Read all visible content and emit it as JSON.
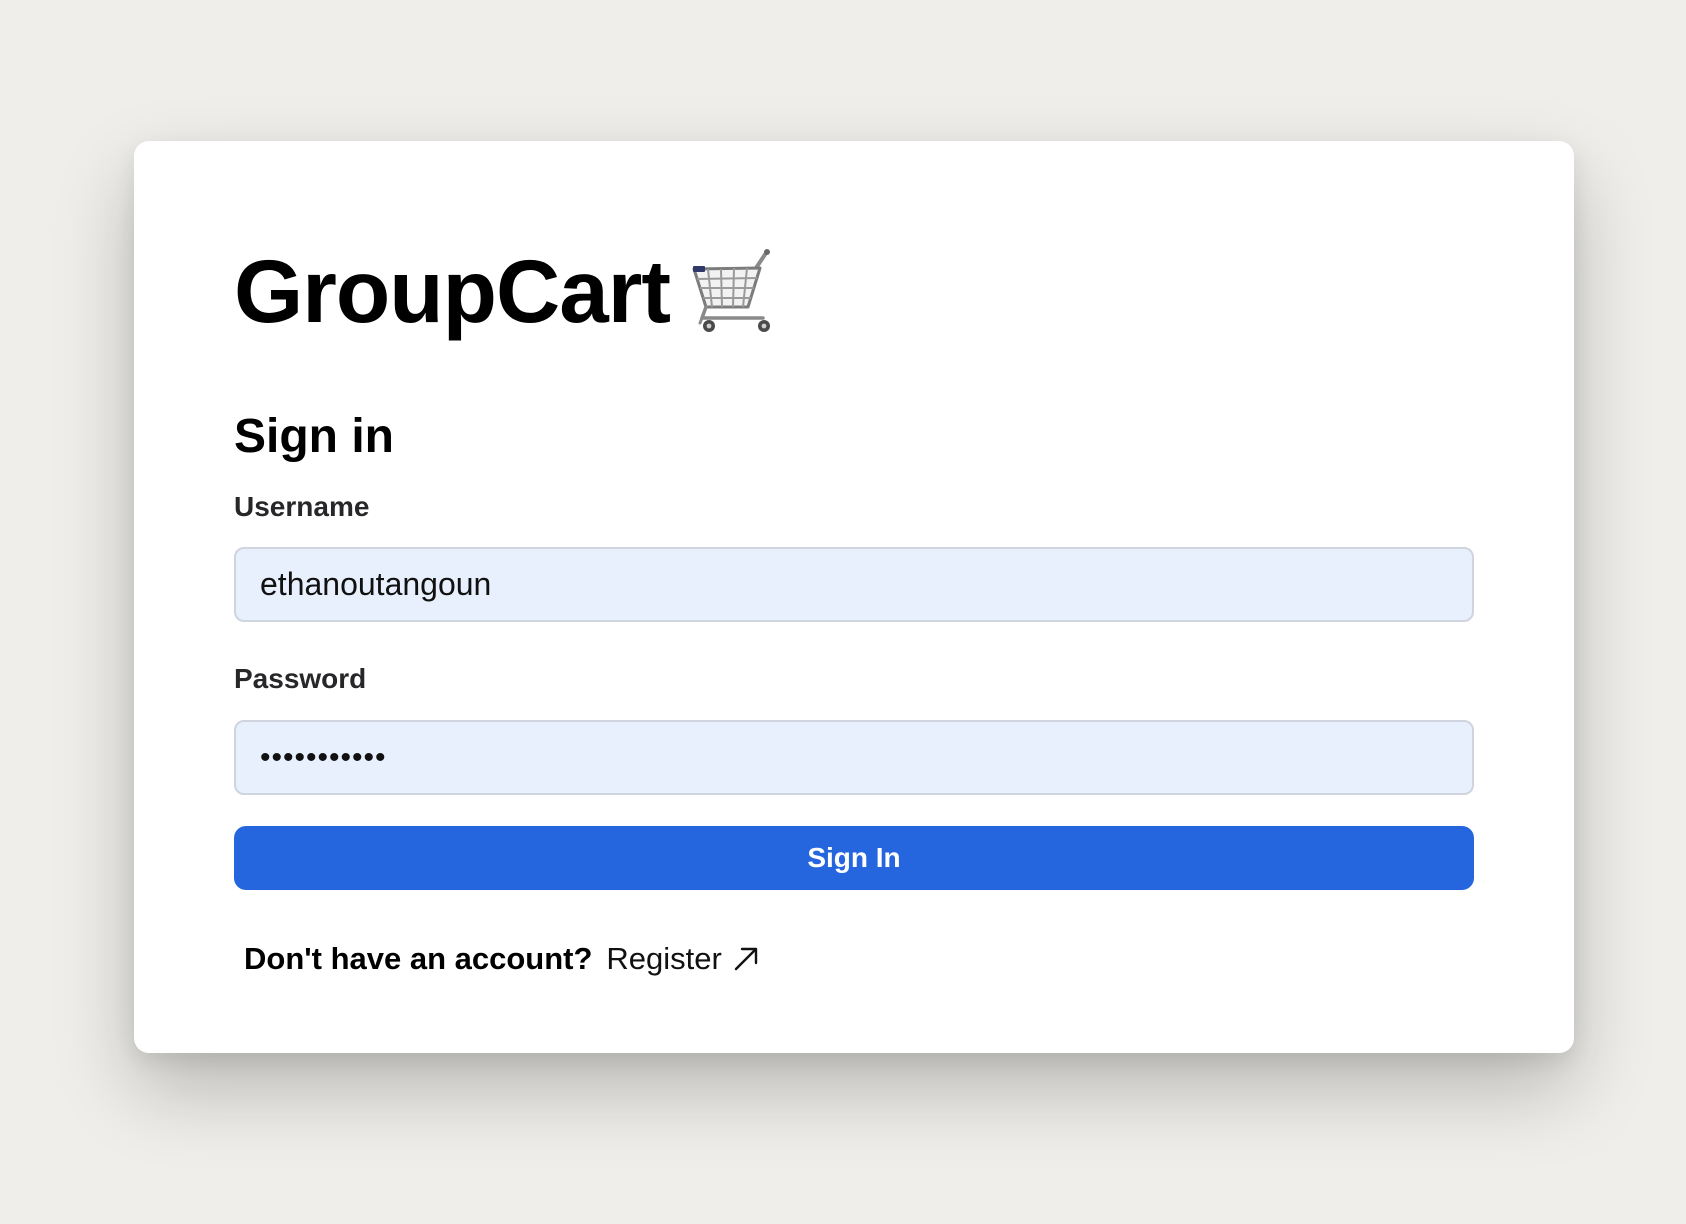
{
  "brand": {
    "title": "GroupCart",
    "icon": "shopping-cart-icon"
  },
  "form": {
    "heading": "Sign in",
    "username_label": "Username",
    "username_value": "ethanoutangoun",
    "password_label": "Password",
    "password_display": "•••••••••••",
    "submit_label": "Sign In"
  },
  "footer": {
    "prompt": "Don't have an account?",
    "register_label": "Register",
    "register_icon": "arrow-up-right-icon"
  },
  "colors": {
    "page_background": "#efeeea",
    "card_background": "#ffffff",
    "input_background": "#e8f0fd",
    "button_background": "#2566df",
    "button_text": "#ffffff"
  }
}
